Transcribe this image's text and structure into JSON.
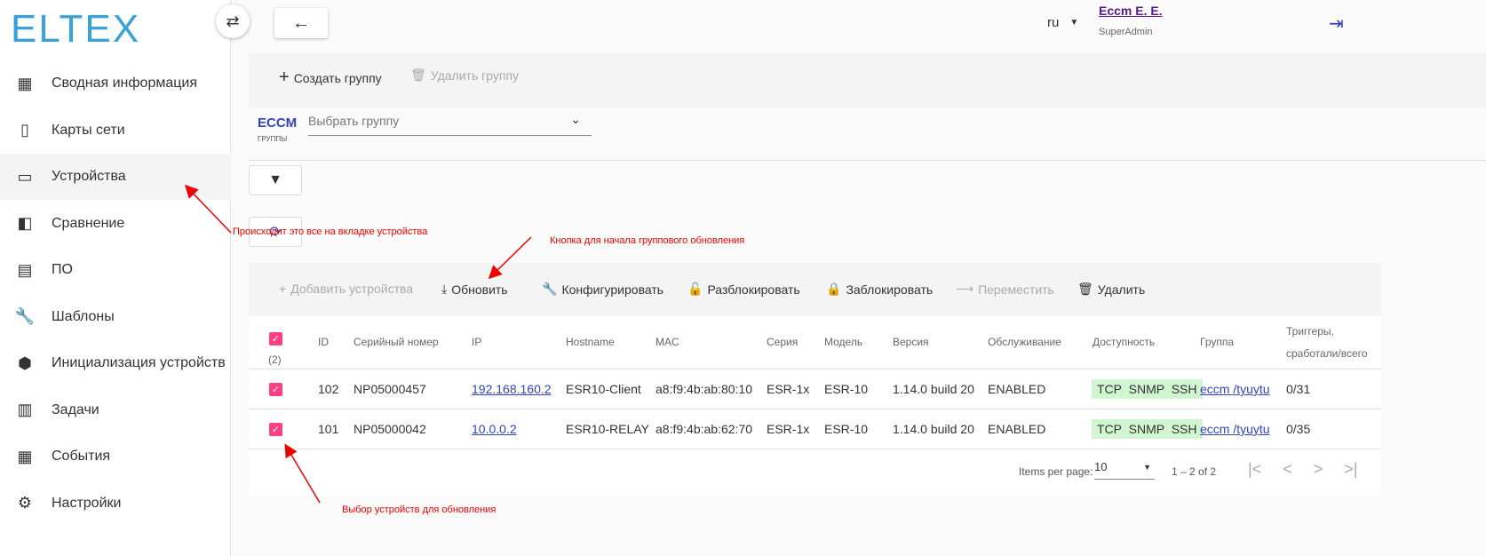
{
  "logo": "ELTEX",
  "sidebar": {
    "items": [
      {
        "label": "Сводная информация",
        "icon": "dashboard-icon",
        "glyph": "▦"
      },
      {
        "label": "Карты сети",
        "icon": "map-icon",
        "glyph": "▯"
      },
      {
        "label": "Устройства",
        "icon": "devices-icon",
        "glyph": "▭"
      },
      {
        "label": "Сравнение",
        "icon": "compare-icon",
        "glyph": "◧"
      },
      {
        "label": "ПО",
        "icon": "store-icon",
        "glyph": "▤"
      },
      {
        "label": "Шаблоны",
        "icon": "wrench-icon",
        "glyph": "🔧"
      },
      {
        "label": "Инициализация устройств",
        "icon": "init-icon",
        "glyph": "⬢"
      },
      {
        "label": "Задачи",
        "icon": "assignment-icon",
        "glyph": "▥"
      },
      {
        "label": "События",
        "icon": "calendar-icon",
        "glyph": "▦"
      },
      {
        "label": "Настройки",
        "icon": "gear-icon",
        "glyph": "⚙"
      }
    ]
  },
  "header": {
    "lang": "ru",
    "user": "Eccm E. E.",
    "role": "SuperAdmin"
  },
  "groups": {
    "create": "Создать группу",
    "delete": "Удалить группу",
    "label": "ECCM",
    "sub": "ГРУППЫ",
    "placeholder": "Выбрать группу"
  },
  "toolbar": {
    "add": "Добавить устройства",
    "update": "Обновить",
    "configure": "Конфигурировать",
    "unlock": "Разблокировать",
    "lock": "Заблокировать",
    "move": "Переместить",
    "delete": "Удалить"
  },
  "table": {
    "selected_count": "(2)",
    "headers": [
      "ID",
      "Серийный номер",
      "IP",
      "Hostname",
      "MAC",
      "Серия",
      "Модель",
      "Версия",
      "Обслуживание",
      "Доступность",
      "Группа",
      "Триггеры,",
      "сработали/всего"
    ],
    "rows": [
      {
        "id": "102",
        "serial": "NP05000457",
        "ip": "192.168.160.2",
        "host": "ESR10-Client",
        "mac": "a8:f9:4b:ab:80:10",
        "series": "ESR-1x",
        "model": "ESR-10",
        "version": "1.14.0 build 20",
        "service": "ENABLED",
        "avail": "TCP SNMP SSH",
        "group": "eccm /tyuytu",
        "triggers": "0/31"
      },
      {
        "id": "101",
        "serial": "NP05000042",
        "ip": "10.0.0.2",
        "host": "ESR10-RELAY",
        "mac": "a8:f9:4b:ab:62:70",
        "series": "ESR-1x",
        "model": "ESR-10",
        "version": "1.14.0 build 20",
        "service": "ENABLED",
        "avail": "TCP SNMP SSH",
        "group": "eccm /tyuytu",
        "triggers": "0/35"
      }
    ]
  },
  "pagination": {
    "label": "Items per page:",
    "size": "10",
    "range": "1 – 2 of 2"
  },
  "annotations": {
    "a1": "Происходит это все на вкладке устройства",
    "a2": "Кнопка для начала группового обновления",
    "a3": "Выбор устройств для обновления"
  }
}
